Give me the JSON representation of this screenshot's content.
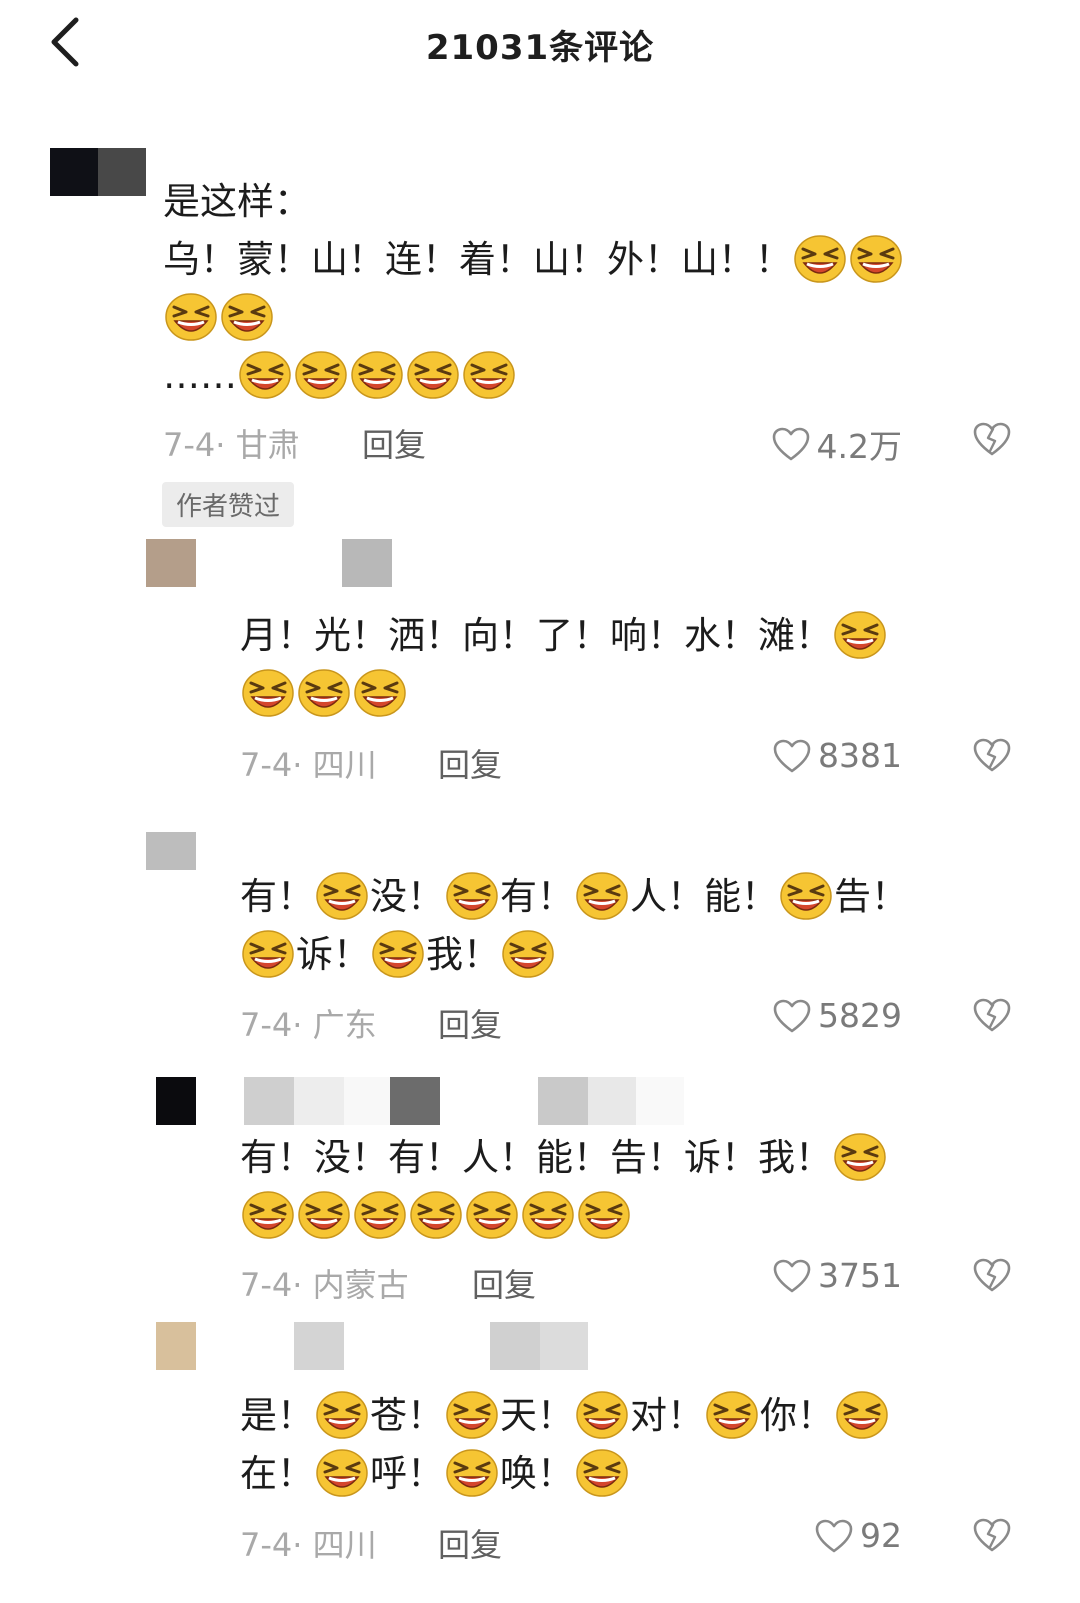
{
  "header": {
    "title": "21031条评论",
    "back_icon": "chevron-left-icon"
  },
  "comments": [
    {
      "lines": [
        [
          "是这样："
        ],
        [
          "乌！",
          "蒙！",
          "山！",
          "连！",
          "着！",
          "山！",
          "外！",
          "山！",
          "！",
          "[E]",
          "[E]"
        ],
        [
          "[E]",
          "[E]"
        ],
        [
          "……",
          "[E]",
          "[E]",
          "[E]",
          "[E]",
          "[E]"
        ]
      ],
      "date": "7-4",
      "location": "甘肃",
      "reply_label": "回复",
      "likes": "4.2万",
      "badge": "作者赞过"
    },
    {
      "lines": [
        [
          "月！",
          "光！",
          "洒！",
          "向！",
          "了！",
          "响！",
          "水！",
          "滩！",
          "[E]"
        ],
        [
          "[E]",
          "[E]",
          "[E]"
        ]
      ],
      "date": "7-4",
      "location": "四川",
      "reply_label": "回复",
      "likes": "8381"
    },
    {
      "lines": [
        [
          "有！",
          "[E]",
          "没！",
          "[E]",
          "有！",
          "[E]",
          "人！",
          "能！",
          "[E]",
          "告！"
        ],
        [
          "[E]",
          "诉！",
          "[E]",
          "我！",
          "[E]"
        ]
      ],
      "date": "7-4",
      "location": "广东",
      "reply_label": "回复",
      "likes": "5829"
    },
    {
      "lines": [
        [
          "有！",
          "没！",
          "有！",
          "人！",
          "能！",
          "告！",
          "诉！",
          "我！",
          "[E]"
        ],
        [
          "[E]",
          "[E]",
          "[E]",
          "[E]",
          "[E]",
          "[E]",
          "[E]"
        ]
      ],
      "date": "7-4",
      "location": "内蒙古",
      "reply_label": "回复",
      "likes": "3751"
    },
    {
      "lines": [
        [
          "是！",
          "[E]",
          "苍！",
          "[E]",
          "天！",
          "[E]",
          "对！",
          "[E]",
          "你！",
          "[E]"
        ],
        [
          "在！",
          "[E]",
          "呼！",
          "[E]",
          "唤！",
          "[E]"
        ]
      ],
      "date": "7-4",
      "location": "四川",
      "reply_label": "回复",
      "likes": "92"
    }
  ],
  "emoji_icon": "grinning-squint-emoji-icon",
  "like_icon": "heart-outline-icon",
  "dislike_icon": "broken-heart-icon",
  "colors": {
    "text": "#1c1c1c",
    "meta": "#a9a9a9",
    "reply": "#606060",
    "badge_bg": "#ececec",
    "emoji_face": "#f6c533",
    "emoji_mouth": "#d4462c"
  }
}
